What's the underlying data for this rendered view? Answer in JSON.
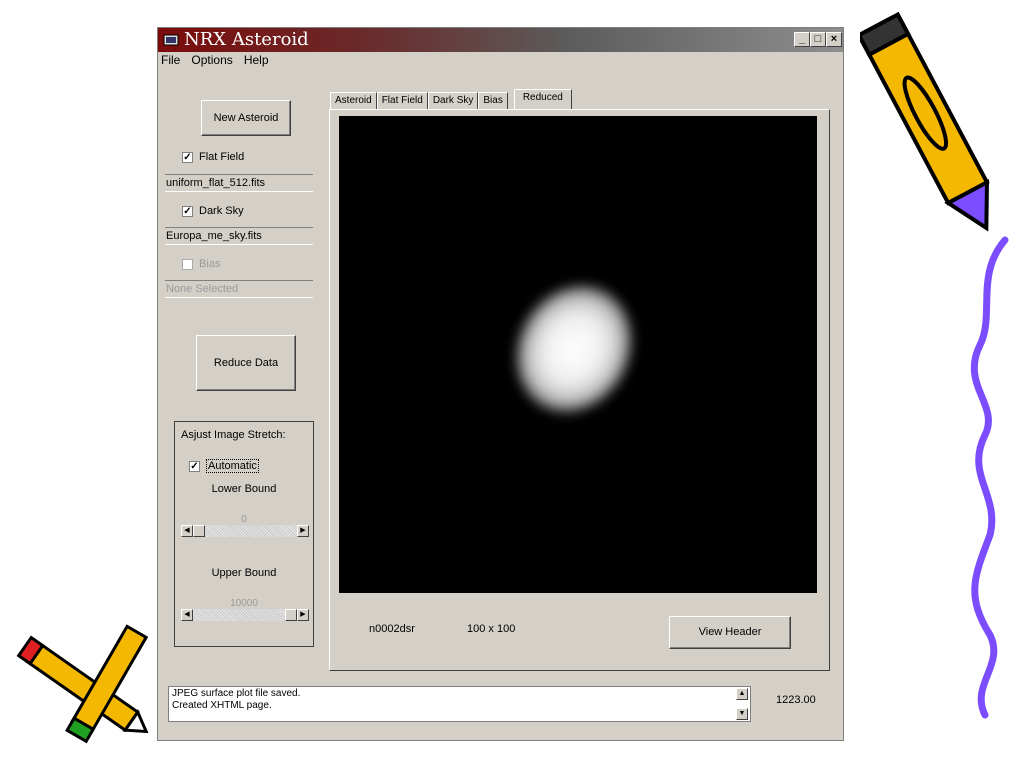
{
  "window": {
    "title": "NRX Asteroid",
    "controls": {
      "minimize": "_",
      "maximize": "□",
      "close": "×"
    }
  },
  "menu": [
    "File",
    "Options",
    "Help"
  ],
  "left_panel": {
    "new_asteroid_button": "New Asteroid",
    "flat_field": {
      "label": "Flat Field",
      "checked": true,
      "file": "uniform_flat_512.fits"
    },
    "dark_sky": {
      "label": "Dark Sky",
      "checked": true,
      "file": "Europa_me_sky.fits"
    },
    "bias": {
      "label": "Bias",
      "checked": false,
      "file": "None Selected"
    },
    "reduce_button": "Reduce Data"
  },
  "stretch": {
    "title": "Asjust Image Stretch:",
    "automatic_label": "Automatic",
    "automatic_checked": true,
    "lower_label": "Lower Bound",
    "lower_value": "0",
    "upper_label": "Upper Bound",
    "upper_value": "10000"
  },
  "tabs": [
    {
      "label": "Asteroid",
      "active": false
    },
    {
      "label": "Flat Field",
      "active": false
    },
    {
      "label": "Dark Sky",
      "active": false
    },
    {
      "label": "Bias",
      "active": false
    },
    {
      "label": "Reduced",
      "active": true
    }
  ],
  "image_info": {
    "name": "n0002dsr",
    "size": "100 x  100"
  },
  "view_header_button": "View Header",
  "status": {
    "lines": [
      "JPEG surface plot file saved.",
      "Created XHTML page."
    ]
  },
  "readout": "1223.00",
  "colors": {
    "title_start": "#7b0b0b",
    "panel_bg": "#d4d0c8",
    "pencil_yellow": "#f5b800",
    "wave_purple": "#7b4dff"
  }
}
